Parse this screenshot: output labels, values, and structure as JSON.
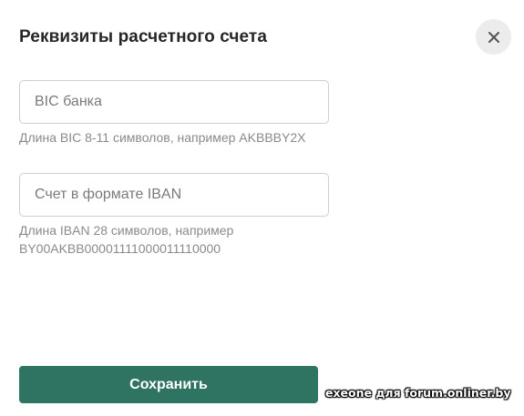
{
  "dialog": {
    "title": "Реквизиты расчетного счета",
    "close_icon": "close-icon"
  },
  "form": {
    "bic": {
      "placeholder": "BIC банка",
      "value": "",
      "hint": "Длина BIC 8-11 символов, например AKBBBY2X"
    },
    "iban": {
      "placeholder": "Счет в формате IBAN",
      "value": "",
      "hint_line1": "Длина IBAN 28 символов, например",
      "hint_line2": "BY00AKBB00001111000011110000"
    },
    "save_label": "Сохранить"
  },
  "watermark": "exeone для forum.onliner.by",
  "colors": {
    "accent": "#2f7362",
    "close_bg": "#ececec",
    "border": "#cfcfcf",
    "hint": "#8a8a8a"
  }
}
